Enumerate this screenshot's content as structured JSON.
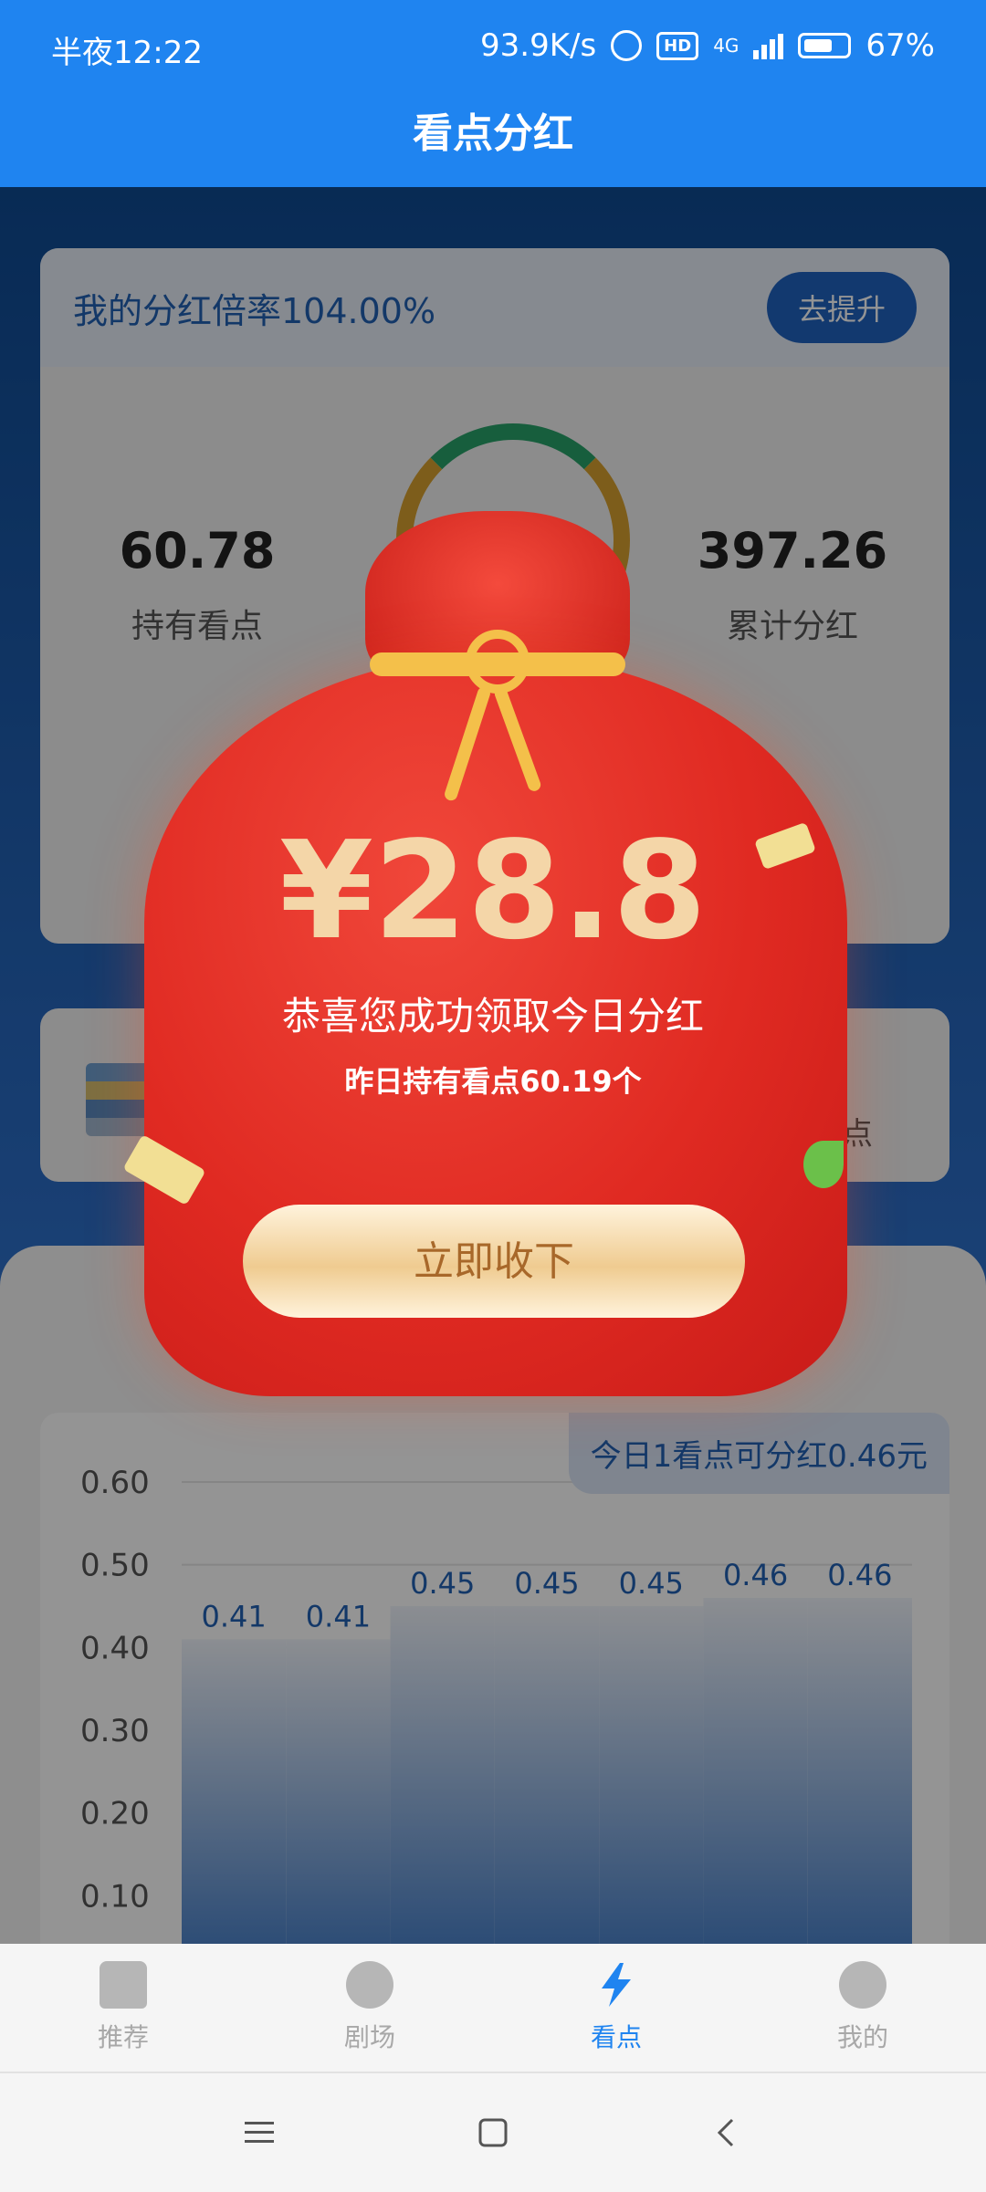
{
  "status_bar": {
    "time": "半夜12:22",
    "speed": "93.9K/s",
    "network": "4G",
    "battery": "67%"
  },
  "header": {
    "title": "看点分红"
  },
  "card_rate": {
    "rate_text": "我的分红倍率104.00%",
    "upgrade_button": "去提升",
    "holding_value": "60.78",
    "holding_label": "持有看点",
    "total_value": "397.26",
    "total_label": "累计分红"
  },
  "card_second": {
    "tail_text": "点"
  },
  "chart_tag": "今日1看点可分红0.46元",
  "chart_data": {
    "type": "bar",
    "categories": [
      "",
      "",
      "",
      "",
      "",
      "",
      ""
    ],
    "values": [
      0.41,
      0.41,
      0.45,
      0.45,
      0.45,
      0.46,
      0.46
    ],
    "y_ticks": [
      "0.60",
      "0.50",
      "0.40",
      "0.30",
      "0.20",
      "0.10"
    ],
    "ylim": [
      0,
      0.6
    ],
    "grid": true
  },
  "popup": {
    "amount": "¥28.8",
    "congrats": "恭喜您成功领取今日分红",
    "yesterday": "昨日持有看点60.19个",
    "claim_button": "立即收下"
  },
  "nav": {
    "items": [
      {
        "label": "推荐",
        "icon": "home-icon"
      },
      {
        "label": "剧场",
        "icon": "film-reel-icon"
      },
      {
        "label": "看点",
        "icon": "lightning-icon"
      },
      {
        "label": "我的",
        "icon": "profile-face-icon"
      }
    ]
  }
}
